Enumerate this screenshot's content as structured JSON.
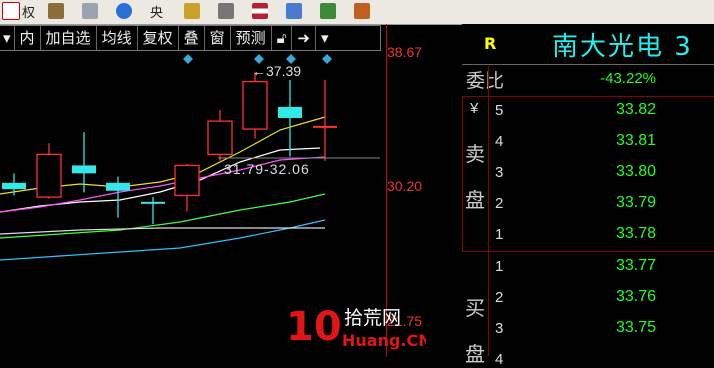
{
  "toolbar": {
    "items": [
      {
        "label": "权",
        "icon": "rights-icon",
        "color": "#d8312a"
      },
      {
        "label": "",
        "icon": "book-icon",
        "color": "#8a6d3b"
      },
      {
        "label": "",
        "icon": "news-icon",
        "color": "#9aa3b0"
      },
      {
        "label": "",
        "icon": "disc-icon",
        "color": "#2a6fd6"
      },
      {
        "label": "央",
        "icon": "central-icon",
        "color": "#3a3a3a"
      },
      {
        "label": "",
        "icon": "money-icon",
        "color": "#c9a227"
      },
      {
        "label": "",
        "icon": "hk-icon",
        "color": "#666"
      },
      {
        "label": "",
        "icon": "us-flag-icon",
        "color": "#b22234"
      },
      {
        "label": "",
        "icon": "edit-icon",
        "color": "#4a7bd0"
      },
      {
        "label": "",
        "icon": "chart-icon",
        "color": "#3a8a3a"
      },
      {
        "label": "",
        "icon": "home-icon",
        "color": "#c06020"
      }
    ]
  },
  "chart_toolbar": {
    "items": [
      "内",
      "加自选",
      "均线",
      "复权",
      "叠",
      "窗",
      "预测"
    ],
    "lock_icon": "lock-icon",
    "pin_icon": "pin-icon",
    "menu_icon": "dropdown-icon"
  },
  "chart": {
    "y_top_label": "38.67",
    "y_mid_label": "30.20",
    "y_bottom_label": "21.75",
    "high_annotation": "←37.39",
    "low_annotation": "31.79-32.06",
    "colors": {
      "up": "#ff3232",
      "down": "#33e8e8",
      "ma5": "#ffffff",
      "ma10": "#f0e020",
      "ma20": "#ff50ff",
      "ma30": "#40ff40",
      "ma60": "#30c0ff"
    }
  },
  "chart_data": {
    "type": "candlestick",
    "candles": [
      {
        "open": 30.4,
        "close": 30.0,
        "high": 31.0,
        "low": 29.6,
        "dir": "down"
      },
      {
        "open": 29.5,
        "close": 32.2,
        "high": 32.9,
        "low": 29.4,
        "dir": "up"
      },
      {
        "open": 31.5,
        "close": 31.0,
        "high": 33.6,
        "low": 29.8,
        "dir": "down"
      },
      {
        "open": 30.4,
        "close": 29.9,
        "high": 30.8,
        "low": 28.2,
        "dir": "down"
      },
      {
        "open": 29.2,
        "close": 29.1,
        "high": 29.5,
        "low": 27.8,
        "dir": "down"
      },
      {
        "open": 29.6,
        "close": 31.5,
        "high": 31.6,
        "low": 28.6,
        "dir": "up"
      },
      {
        "open": 32.2,
        "close": 34.3,
        "high": 35.0,
        "low": 31.8,
        "dir": "up"
      },
      {
        "open": 33.8,
        "close": 36.8,
        "high": 37.39,
        "low": 33.2,
        "dir": "up"
      },
      {
        "open": 35.2,
        "close": 34.5,
        "high": 36.9,
        "low": 32.06,
        "dir": "down"
      },
      {
        "open": 34.0,
        "close": 34.0,
        "high": 36.9,
        "low": 31.79,
        "dir": "flat"
      }
    ]
  },
  "quote": {
    "badge": "R",
    "title": "南大光电 3",
    "weibi_label": "委比",
    "weibi_value": "-43.22%",
    "sell_label": [
      "¥",
      "卖",
      "盘"
    ],
    "buy_label": [
      "买",
      "盘"
    ],
    "sell": [
      {
        "level": "5",
        "price": "33.82"
      },
      {
        "level": "4",
        "price": "33.81"
      },
      {
        "level": "3",
        "price": "33.80"
      },
      {
        "level": "2",
        "price": "33.79"
      },
      {
        "level": "1",
        "price": "33.78"
      }
    ],
    "buy": [
      {
        "level": "1",
        "price": "33.77"
      },
      {
        "level": "2",
        "price": "33.76"
      },
      {
        "level": "3",
        "price": "33.75"
      },
      {
        "level": "4",
        "price": ""
      }
    ]
  },
  "watermark": {
    "number": "10",
    "chinese": "拾荒网",
    "site": "Huang.CN"
  }
}
